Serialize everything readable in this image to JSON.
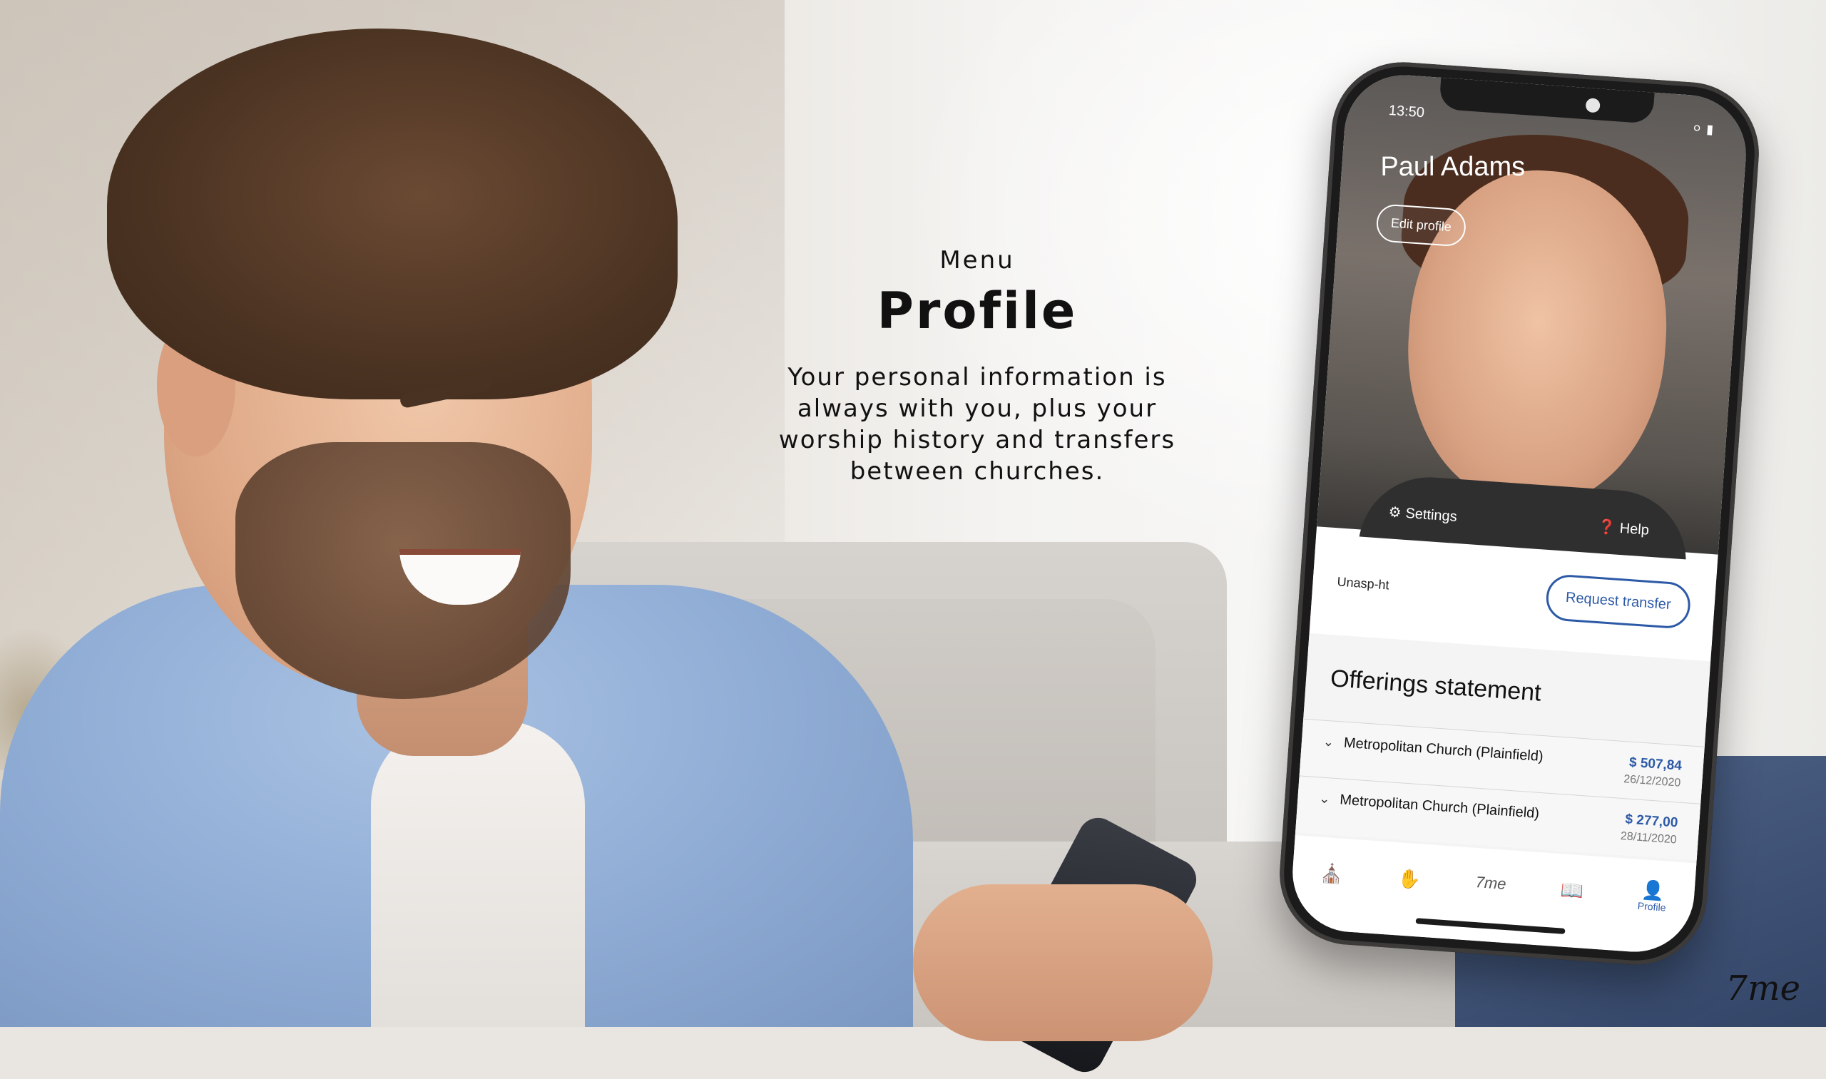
{
  "headline": {
    "eyebrow": "Menu",
    "title": "Profile",
    "body": "Your personal information is always with you, plus your worship history and transfers between churches."
  },
  "phone": {
    "status": {
      "time": "13:50",
      "icons": "wifi-icon battery-icon"
    },
    "profile": {
      "name": "Paul Adams",
      "edit_label": "Edit profile",
      "settings_label": "Settings",
      "help_label": "Help"
    },
    "church": {
      "label": "Unasp-ht",
      "transfer_label": "Request transfer"
    },
    "offerings": {
      "title": "Offerings statement",
      "items": [
        {
          "church": "Metropolitan Church (Plainfield)",
          "amount": "$ 507,84",
          "date": "26/12/2020"
        },
        {
          "church": "Metropolitan Church (Plainfield)",
          "amount": "$ 277,00",
          "date": "28/11/2020"
        }
      ]
    },
    "tabbar": {
      "tabs": [
        {
          "icon": "church-icon",
          "label": ""
        },
        {
          "icon": "praying-hands-icon",
          "label": ""
        },
        {
          "icon": "7me-logo-icon",
          "label": ""
        },
        {
          "icon": "book-icon",
          "label": ""
        },
        {
          "icon": "person-icon",
          "label": "Profile",
          "active": true
        }
      ]
    }
  },
  "brand": {
    "logo_text": "7me"
  },
  "colors": {
    "accent": "#2d5aa6",
    "text": "#111111"
  }
}
